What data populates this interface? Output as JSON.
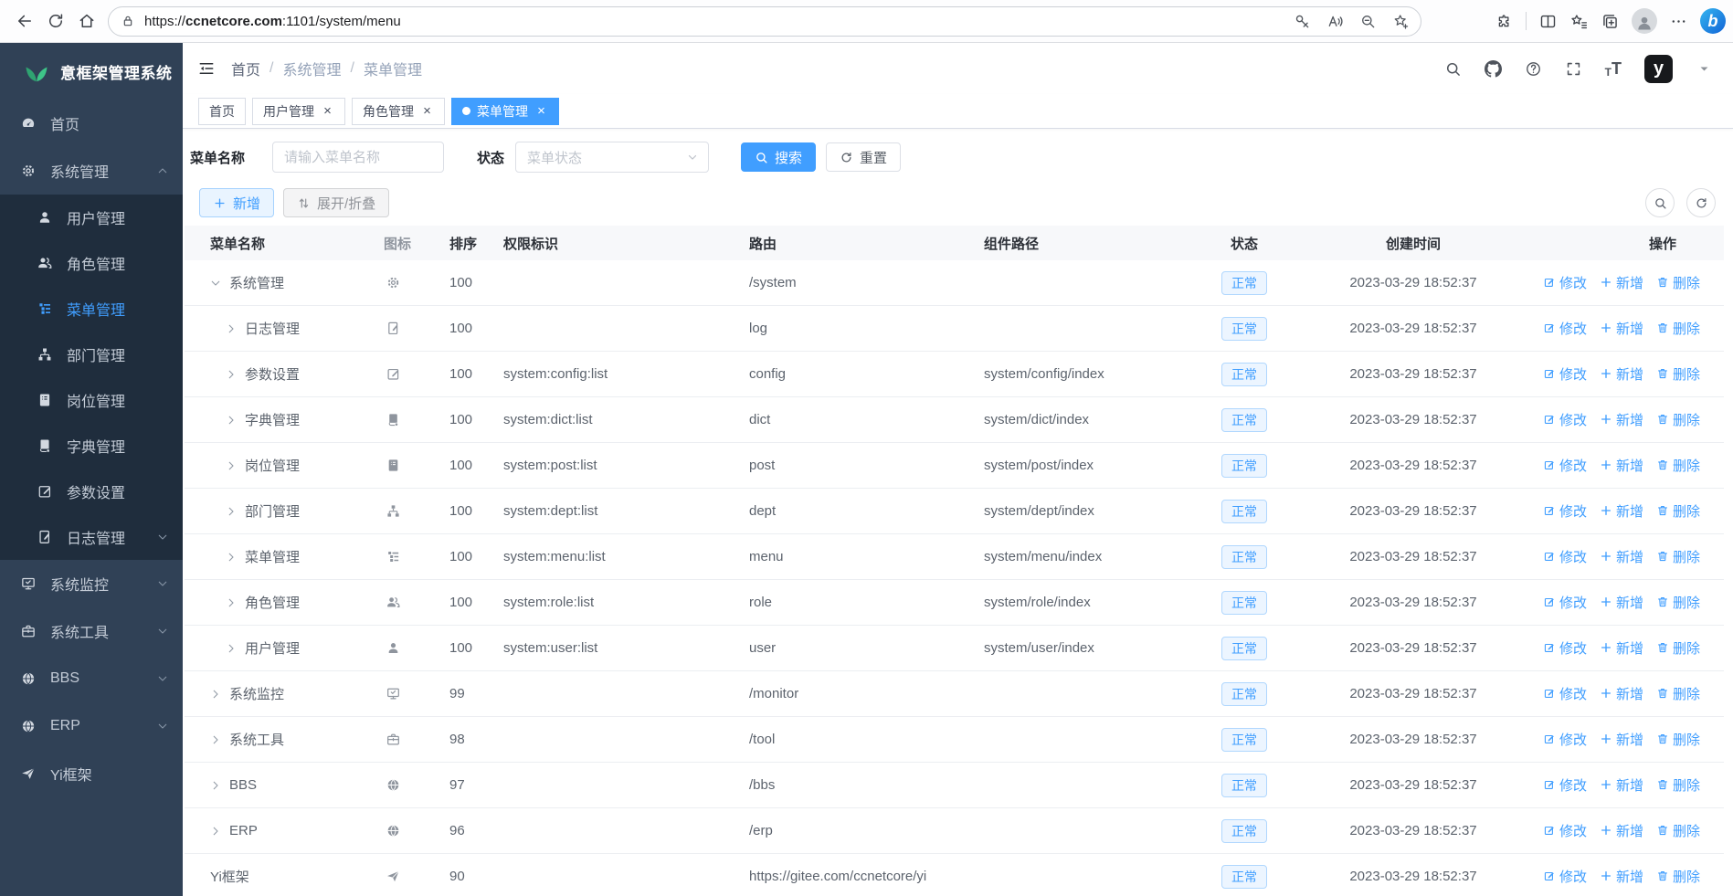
{
  "browser": {
    "url_prefix": "https://",
    "url_domain": "ccnetcore.com",
    "url_rest": ":1101/system/menu",
    "url_full": "https://ccnetcore.com:1101/system/menu"
  },
  "sidebar": {
    "logo_text": "意框架管理系统",
    "items": [
      {
        "label": "首页",
        "icon": "dashboard"
      },
      {
        "label": "系统管理",
        "icon": "gear",
        "chevron": "up",
        "children": [
          {
            "label": "用户管理",
            "icon": "user"
          },
          {
            "label": "角色管理",
            "icon": "users"
          },
          {
            "label": "菜单管理",
            "icon": "menu-list",
            "active": true
          },
          {
            "label": "部门管理",
            "icon": "org-tree"
          },
          {
            "label": "岗位管理",
            "icon": "id-card"
          },
          {
            "label": "字典管理",
            "icon": "book"
          },
          {
            "label": "参数设置",
            "icon": "pen-square"
          },
          {
            "label": "日志管理",
            "icon": "doc-pen",
            "chevron": "down"
          }
        ]
      },
      {
        "label": "系统监控",
        "icon": "monitor",
        "chevron": "down"
      },
      {
        "label": "系统工具",
        "icon": "toolbox",
        "chevron": "down"
      },
      {
        "label": "BBS",
        "icon": "globe",
        "chevron": "down"
      },
      {
        "label": "ERP",
        "icon": "globe",
        "chevron": "down"
      },
      {
        "label": "Yi框架",
        "icon": "paper-plane"
      }
    ]
  },
  "navbar": {
    "breadcrumb": [
      "首页",
      "系统管理",
      "菜单管理"
    ],
    "separator": "/",
    "right_icons": [
      "search",
      "github",
      "question",
      "fullscreen",
      "font-size"
    ],
    "avatar_text": "y"
  },
  "tabs": [
    {
      "label": "首页",
      "closable": false,
      "active": false
    },
    {
      "label": "用户管理",
      "closable": true,
      "active": false
    },
    {
      "label": "角色管理",
      "closable": true,
      "active": false
    },
    {
      "label": "菜单管理",
      "closable": true,
      "active": true
    }
  ],
  "filters": {
    "name_label": "菜单名称",
    "name_placeholder": "请输入菜单名称",
    "status_label": "状态",
    "status_placeholder": "菜单状态",
    "search_label": "搜索",
    "reset_label": "重置"
  },
  "toolbar": {
    "add_label": "新增",
    "toggle_label": "展开/折叠"
  },
  "table": {
    "headers": [
      "菜单名称",
      "图标",
      "排序",
      "权限标识",
      "路由",
      "组件路径",
      "状态",
      "创建时间",
      "操作"
    ],
    "actions": {
      "edit": "修改",
      "add": "新增",
      "del": "删除"
    },
    "rows": [
      {
        "name": "系统管理",
        "icon": "gear",
        "level": 0,
        "arrow": "down",
        "sort": "100",
        "perm": "",
        "route": "/system",
        "component": "",
        "status": "正常",
        "created": "2023-03-29 18:52:37"
      },
      {
        "name": "日志管理",
        "icon": "doc-pen",
        "level": 1,
        "arrow": "right",
        "sort": "100",
        "perm": "",
        "route": "log",
        "component": "",
        "status": "正常",
        "created": "2023-03-29 18:52:37"
      },
      {
        "name": "参数设置",
        "icon": "pen-square",
        "level": 1,
        "arrow": "right",
        "sort": "100",
        "perm": "system:config:list",
        "route": "config",
        "component": "system/config/index",
        "status": "正常",
        "created": "2023-03-29 18:52:37"
      },
      {
        "name": "字典管理",
        "icon": "book",
        "level": 1,
        "arrow": "right",
        "sort": "100",
        "perm": "system:dict:list",
        "route": "dict",
        "component": "system/dict/index",
        "status": "正常",
        "created": "2023-03-29 18:52:37"
      },
      {
        "name": "岗位管理",
        "icon": "id-card",
        "level": 1,
        "arrow": "right",
        "sort": "100",
        "perm": "system:post:list",
        "route": "post",
        "component": "system/post/index",
        "status": "正常",
        "created": "2023-03-29 18:52:37"
      },
      {
        "name": "部门管理",
        "icon": "org-tree",
        "level": 1,
        "arrow": "right",
        "sort": "100",
        "perm": "system:dept:list",
        "route": "dept",
        "component": "system/dept/index",
        "status": "正常",
        "created": "2023-03-29 18:52:37"
      },
      {
        "name": "菜单管理",
        "icon": "menu-list",
        "level": 1,
        "arrow": "right",
        "sort": "100",
        "perm": "system:menu:list",
        "route": "menu",
        "component": "system/menu/index",
        "status": "正常",
        "created": "2023-03-29 18:52:37"
      },
      {
        "name": "角色管理",
        "icon": "users",
        "level": 1,
        "arrow": "right",
        "sort": "100",
        "perm": "system:role:list",
        "route": "role",
        "component": "system/role/index",
        "status": "正常",
        "created": "2023-03-29 18:52:37"
      },
      {
        "name": "用户管理",
        "icon": "user",
        "level": 1,
        "arrow": "right",
        "sort": "100",
        "perm": "system:user:list",
        "route": "user",
        "component": "system/user/index",
        "status": "正常",
        "created": "2023-03-29 18:52:37"
      },
      {
        "name": "系统监控",
        "icon": "monitor",
        "level": 0,
        "arrow": "right",
        "sort": "99",
        "perm": "",
        "route": "/monitor",
        "component": "",
        "status": "正常",
        "created": "2023-03-29 18:52:37"
      },
      {
        "name": "系统工具",
        "icon": "toolbox",
        "level": 0,
        "arrow": "right",
        "sort": "98",
        "perm": "",
        "route": "/tool",
        "component": "",
        "status": "正常",
        "created": "2023-03-29 18:52:37"
      },
      {
        "name": "BBS",
        "icon": "globe",
        "level": 0,
        "arrow": "right",
        "sort": "97",
        "perm": "",
        "route": "/bbs",
        "component": "",
        "status": "正常",
        "created": "2023-03-29 18:52:37"
      },
      {
        "name": "ERP",
        "icon": "globe",
        "level": 0,
        "arrow": "right",
        "sort": "96",
        "perm": "",
        "route": "/erp",
        "component": "",
        "status": "正常",
        "created": "2023-03-29 18:52:37"
      },
      {
        "name": "Yi框架",
        "icon": "paper-plane",
        "level": 0,
        "arrow": "none",
        "sort": "90",
        "perm": "",
        "route": "https://gitee.com/ccnetcore/yi",
        "component": "",
        "status": "正常",
        "created": "2023-03-29 18:52:37"
      }
    ]
  },
  "colors": {
    "accent": "#409eff",
    "sidebar_bg": "#304156",
    "submenu_bg": "#1f2d3d",
    "logo_green": "#3ec488",
    "badge_bg": "#ecf5ff",
    "badge_border": "#b0d7fe",
    "table_header_bg": "#f7f8fa"
  }
}
